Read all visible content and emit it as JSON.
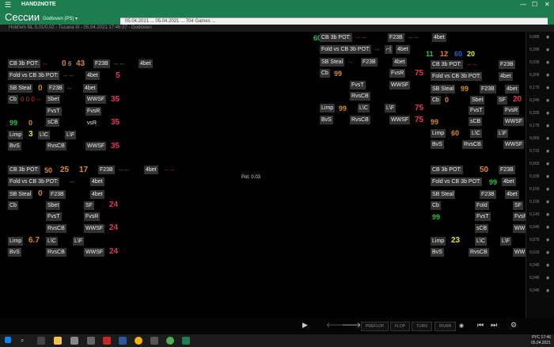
{
  "app": {
    "menu_icon": "hamburger-icon",
    "name": "HAND2NOTE",
    "window_controls": [
      "—",
      "☐",
      "✕"
    ]
  },
  "session": {
    "title": "Сессии",
    "player": "Godloven (PS) ▾",
    "popup_text": "05.04.2021 ... 05.04.2021 ... 704 Games ..."
  },
  "table_info": "Hold'em NL 0,01/0,02 - Tucana III - 05.04.2021 17:46:37 - Godloven",
  "pot": "Pot: 0.03",
  "hud_labels": {
    "cb3b": "CB 3b POT:",
    "fold_cb3b": "Fold vs CB 3b POT:",
    "sb_steal": "SB Steal",
    "f23b": "F23B",
    "fourbet": "4bet",
    "cb": "Cb",
    "xf": "XF",
    "fvst": "FvsT",
    "fvsr": "FvsR",
    "scb": "sCB",
    "rvscb": "RvsCB",
    "wwsf": "WWSF",
    "limp": "Limp",
    "lc": "L\\C",
    "lf": "L\\F",
    "bvs": "BvS",
    "sbet": "Sbet",
    "fold": "Fold"
  },
  "huds": {
    "top_left": {
      "v1": "0",
      "v2": "6",
      "v3": "43",
      "v4": "5",
      "v5": "35",
      "v6": "0",
      "v7": "35",
      "v8": "3",
      "v9": "35",
      "steal": "0"
    },
    "top_right": {
      "v1": "11",
      "v2": "12",
      "v3": "60",
      "v4": "20",
      "v5": "75",
      "v6": "99",
      "v7": "75",
      "v8": "99",
      "v9": "75"
    },
    "right_mid": {
      "v1": "20",
      "v2": "99",
      "v3": "20",
      "v4": "20",
      "v5": "60",
      "v6": "20"
    },
    "bottom_left": {
      "v1": "50",
      "v2": "25",
      "v3": "17",
      "v4": "24",
      "v5": "24",
      "v6": "6.7",
      "v7": "24"
    },
    "bottom_right": {
      "v1": "50",
      "v2": "32",
      "v3": "99",
      "v4": "32",
      "v5": "23",
      "v6": "32"
    }
  },
  "sidebar_values": [
    "0,005",
    "0,395",
    "0,035",
    "0,305",
    "0,175",
    "0,245",
    "0,325",
    "0,175",
    "0,065",
    "0,715",
    "0,565",
    "0,335",
    "0,155",
    "0,195",
    "0,143",
    "0,045",
    "0,075",
    "0,015",
    "0,045",
    "0,045",
    "0,045"
  ],
  "controls": {
    "play_icon": "play-icon",
    "back_icon": "arrow-left-icon",
    "forward_icon": "arrow-right-icon",
    "streets": [
      "PREFLOP",
      "FLOP",
      "TURN",
      "RIVER"
    ],
    "eye_icon": "eye-icon",
    "first_icon": "skip-back-icon",
    "last_icon": "skip-forward-icon",
    "settings_icon": "gear-icon"
  },
  "taskbar": {
    "clock_time": "17:46",
    "clock_date": "05.04.2021",
    "lang": "РУС"
  },
  "colors": {
    "green": "#1e7d4e",
    "orange": "#d98a2a",
    "red": "#e0395a",
    "yellow": "#e6e622",
    "green_val": "#2cc447"
  }
}
